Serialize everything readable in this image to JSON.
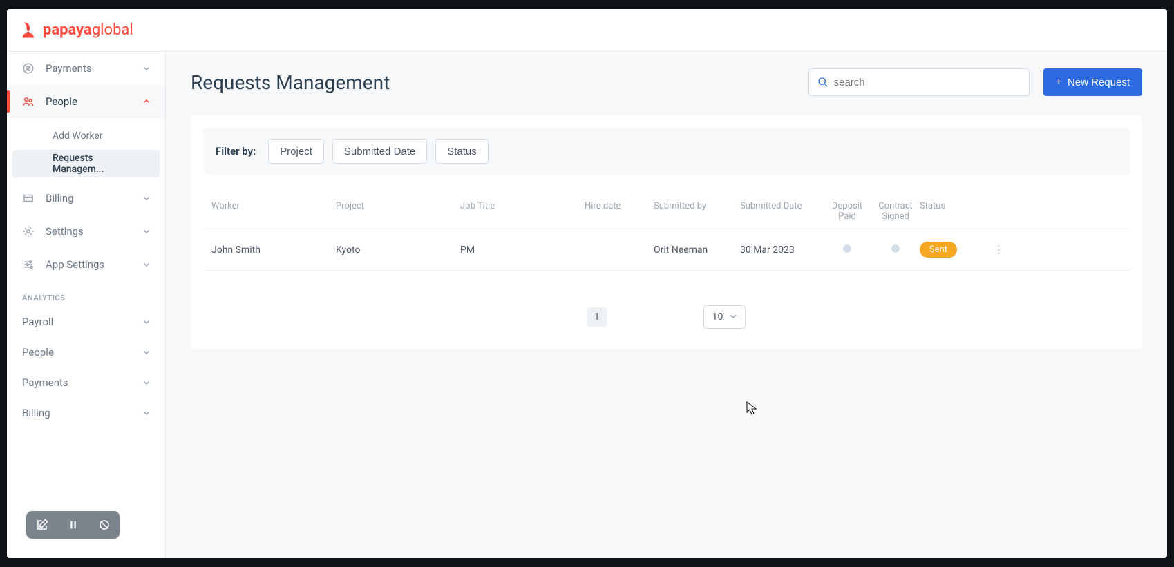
{
  "brand": {
    "name": "papaya",
    "suffix": "global"
  },
  "sidebar": {
    "items": [
      {
        "icon": "dollar",
        "label": "Payments",
        "expanded": false
      },
      {
        "icon": "people",
        "label": "People",
        "expanded": true,
        "active": true,
        "children": [
          {
            "label": "Add Worker",
            "selected": false
          },
          {
            "label": "Requests Managem...",
            "selected": true
          }
        ]
      },
      {
        "icon": "billing",
        "label": "Billing",
        "expanded": false
      },
      {
        "icon": "gear",
        "label": "Settings",
        "expanded": false
      },
      {
        "icon": "sliders",
        "label": "App Settings",
        "expanded": false
      }
    ],
    "analytics_label": "ANALYTICS",
    "analytics": [
      {
        "label": "Payroll"
      },
      {
        "label": "People"
      },
      {
        "label": "Payments"
      },
      {
        "label": "Billing"
      }
    ]
  },
  "page": {
    "title": "Requests Management",
    "search_placeholder": "search",
    "new_request": "New Request"
  },
  "filter": {
    "label": "Filter by:",
    "buttons": [
      "Project",
      "Submitted Date",
      "Status"
    ]
  },
  "table": {
    "headers": {
      "worker": "Worker",
      "project": "Project",
      "jobtitle": "Job Title",
      "hiredate": "Hire date",
      "submittedby": "Submitted by",
      "submitteddate": "Submitted Date",
      "deposit": "Deposit Paid",
      "contract": "Contract Signed",
      "status": "Status"
    },
    "rows": [
      {
        "worker": "John Smith",
        "project": "Kyoto",
        "jobtitle": "PM",
        "hiredate": "",
        "submittedby": "Orit Neeman",
        "submitteddate": "30 Mar 2023",
        "status": "Sent"
      }
    ]
  },
  "pagination": {
    "page": "1",
    "size": "10"
  }
}
